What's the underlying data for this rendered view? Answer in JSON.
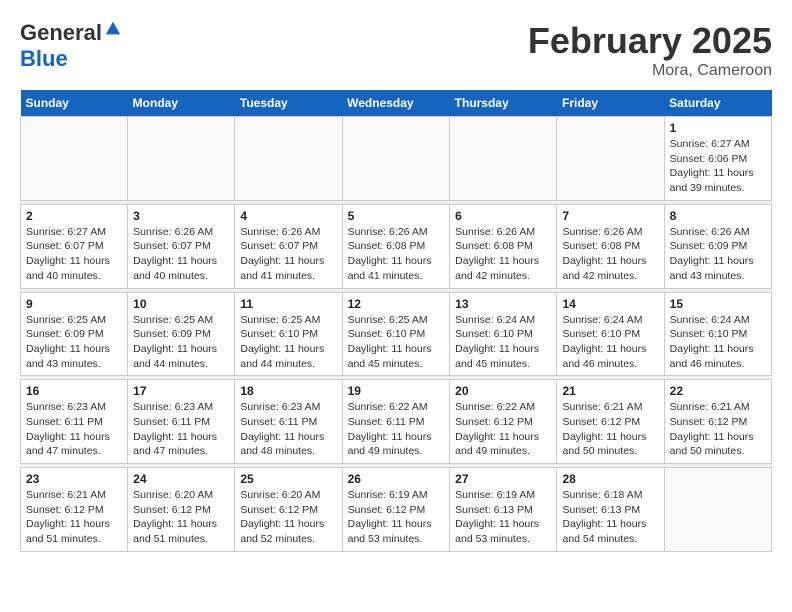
{
  "header": {
    "logo_line1": "General",
    "logo_line2": "Blue",
    "month_title": "February 2025",
    "location": "Mora, Cameroon"
  },
  "weekdays": [
    "Sunday",
    "Monday",
    "Tuesday",
    "Wednesday",
    "Thursday",
    "Friday",
    "Saturday"
  ],
  "weeks": [
    [
      {
        "day": "",
        "info": ""
      },
      {
        "day": "",
        "info": ""
      },
      {
        "day": "",
        "info": ""
      },
      {
        "day": "",
        "info": ""
      },
      {
        "day": "",
        "info": ""
      },
      {
        "day": "",
        "info": ""
      },
      {
        "day": "1",
        "info": "Sunrise: 6:27 AM\nSunset: 6:06 PM\nDaylight: 11 hours\nand 39 minutes."
      }
    ],
    [
      {
        "day": "2",
        "info": "Sunrise: 6:27 AM\nSunset: 6:07 PM\nDaylight: 11 hours\nand 40 minutes."
      },
      {
        "day": "3",
        "info": "Sunrise: 6:26 AM\nSunset: 6:07 PM\nDaylight: 11 hours\nand 40 minutes."
      },
      {
        "day": "4",
        "info": "Sunrise: 6:26 AM\nSunset: 6:07 PM\nDaylight: 11 hours\nand 41 minutes."
      },
      {
        "day": "5",
        "info": "Sunrise: 6:26 AM\nSunset: 6:08 PM\nDaylight: 11 hours\nand 41 minutes."
      },
      {
        "day": "6",
        "info": "Sunrise: 6:26 AM\nSunset: 6:08 PM\nDaylight: 11 hours\nand 42 minutes."
      },
      {
        "day": "7",
        "info": "Sunrise: 6:26 AM\nSunset: 6:08 PM\nDaylight: 11 hours\nand 42 minutes."
      },
      {
        "day": "8",
        "info": "Sunrise: 6:26 AM\nSunset: 6:09 PM\nDaylight: 11 hours\nand 43 minutes."
      }
    ],
    [
      {
        "day": "9",
        "info": "Sunrise: 6:25 AM\nSunset: 6:09 PM\nDaylight: 11 hours\nand 43 minutes."
      },
      {
        "day": "10",
        "info": "Sunrise: 6:25 AM\nSunset: 6:09 PM\nDaylight: 11 hours\nand 44 minutes."
      },
      {
        "day": "11",
        "info": "Sunrise: 6:25 AM\nSunset: 6:10 PM\nDaylight: 11 hours\nand 44 minutes."
      },
      {
        "day": "12",
        "info": "Sunrise: 6:25 AM\nSunset: 6:10 PM\nDaylight: 11 hours\nand 45 minutes."
      },
      {
        "day": "13",
        "info": "Sunrise: 6:24 AM\nSunset: 6:10 PM\nDaylight: 11 hours\nand 45 minutes."
      },
      {
        "day": "14",
        "info": "Sunrise: 6:24 AM\nSunset: 6:10 PM\nDaylight: 11 hours\nand 46 minutes."
      },
      {
        "day": "15",
        "info": "Sunrise: 6:24 AM\nSunset: 6:10 PM\nDaylight: 11 hours\nand 46 minutes."
      }
    ],
    [
      {
        "day": "16",
        "info": "Sunrise: 6:23 AM\nSunset: 6:11 PM\nDaylight: 11 hours\nand 47 minutes."
      },
      {
        "day": "17",
        "info": "Sunrise: 6:23 AM\nSunset: 6:11 PM\nDaylight: 11 hours\nand 47 minutes."
      },
      {
        "day": "18",
        "info": "Sunrise: 6:23 AM\nSunset: 6:11 PM\nDaylight: 11 hours\nand 48 minutes."
      },
      {
        "day": "19",
        "info": "Sunrise: 6:22 AM\nSunset: 6:11 PM\nDaylight: 11 hours\nand 49 minutes."
      },
      {
        "day": "20",
        "info": "Sunrise: 6:22 AM\nSunset: 6:12 PM\nDaylight: 11 hours\nand 49 minutes."
      },
      {
        "day": "21",
        "info": "Sunrise: 6:21 AM\nSunset: 6:12 PM\nDaylight: 11 hours\nand 50 minutes."
      },
      {
        "day": "22",
        "info": "Sunrise: 6:21 AM\nSunset: 6:12 PM\nDaylight: 11 hours\nand 50 minutes."
      }
    ],
    [
      {
        "day": "23",
        "info": "Sunrise: 6:21 AM\nSunset: 6:12 PM\nDaylight: 11 hours\nand 51 minutes."
      },
      {
        "day": "24",
        "info": "Sunrise: 6:20 AM\nSunset: 6:12 PM\nDaylight: 11 hours\nand 51 minutes."
      },
      {
        "day": "25",
        "info": "Sunrise: 6:20 AM\nSunset: 6:12 PM\nDaylight: 11 hours\nand 52 minutes."
      },
      {
        "day": "26",
        "info": "Sunrise: 6:19 AM\nSunset: 6:12 PM\nDaylight: 11 hours\nand 53 minutes."
      },
      {
        "day": "27",
        "info": "Sunrise: 6:19 AM\nSunset: 6:13 PM\nDaylight: 11 hours\nand 53 minutes."
      },
      {
        "day": "28",
        "info": "Sunrise: 6:18 AM\nSunset: 6:13 PM\nDaylight: 11 hours\nand 54 minutes."
      },
      {
        "day": "",
        "info": ""
      }
    ]
  ]
}
